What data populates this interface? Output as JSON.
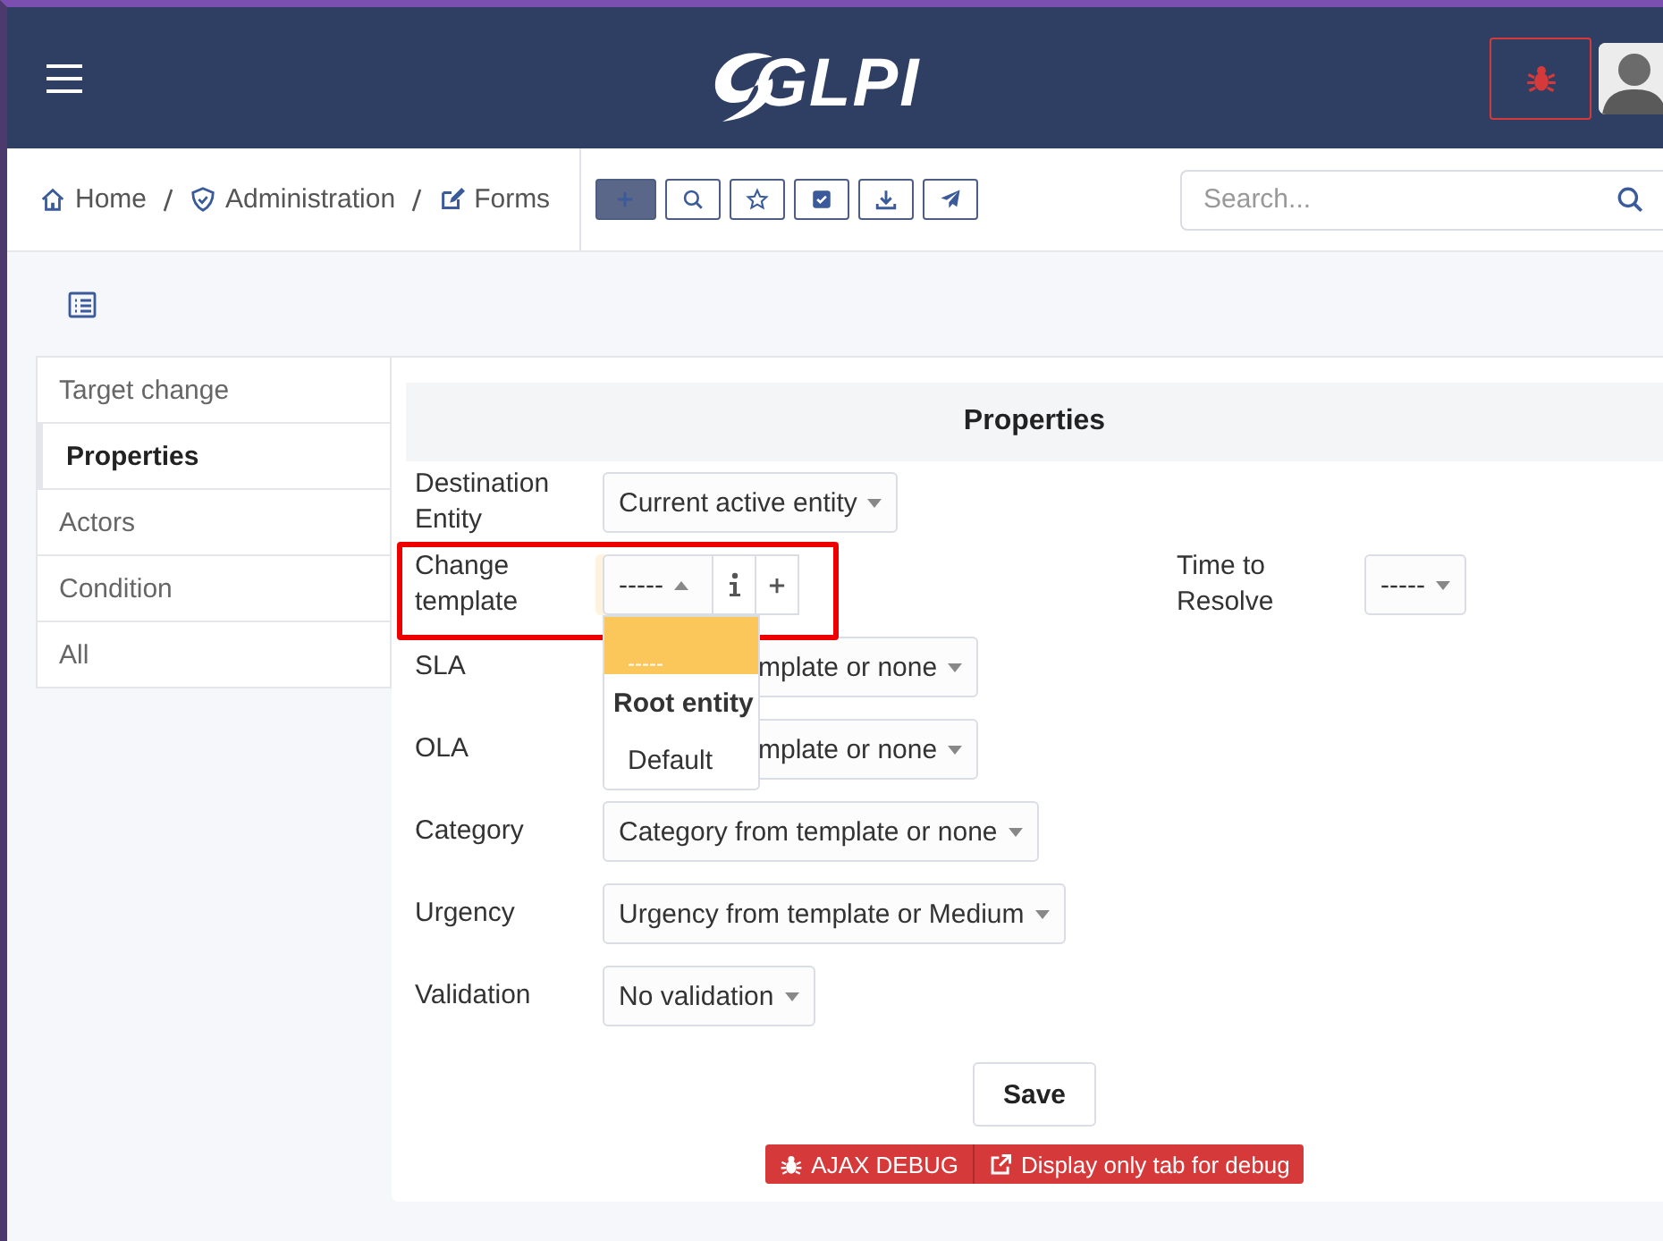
{
  "header": {
    "logo": "GLPI",
    "debug_active": true
  },
  "breadcrumb": [
    {
      "label": "Home"
    },
    {
      "label": "Administration"
    },
    {
      "label": "Forms"
    }
  ],
  "toolbar": [
    {
      "kind": "add"
    },
    {
      "kind": "search"
    },
    {
      "kind": "star"
    },
    {
      "kind": "check"
    },
    {
      "kind": "download"
    },
    {
      "kind": "send"
    }
  ],
  "search": {
    "placeholder": "Search..."
  },
  "tabs": [
    {
      "label": "Target change",
      "selected": false
    },
    {
      "label": "Properties",
      "selected": true
    },
    {
      "label": "Actors",
      "selected": false
    },
    {
      "label": "Condition",
      "selected": false
    },
    {
      "label": "All",
      "selected": false
    }
  ],
  "form": {
    "title": "Properties",
    "rows": [
      [
        {
          "label": "Destination Entity",
          "value": "Current active entity"
        }
      ],
      [
        {
          "label": "Change template",
          "value": "-----",
          "kind": "template",
          "highlighted": true,
          "expanded": true,
          "options": [
            {
              "label": "-----",
              "kind": "item",
              "selected": true
            },
            {
              "label": "Root entity",
              "kind": "group",
              "selected": false
            },
            {
              "label": "Default",
              "kind": "item",
              "selected": false
            }
          ]
        },
        {
          "label": "Time to Resolve",
          "value": "-----"
        }
      ],
      [
        {
          "label": "SLA",
          "value": "mplate or none",
          "kind": "covered"
        }
      ],
      [
        {
          "label": "OLA",
          "value": "mplate or none",
          "kind": "covered"
        }
      ],
      [
        {
          "label": "Category",
          "value": "Category from template or none"
        }
      ],
      [
        {
          "label": "Urgency",
          "value": "Urgency from template or Medium"
        }
      ],
      [
        {
          "label": "Validation",
          "value": "No validation"
        }
      ]
    ],
    "save": "Save"
  },
  "debug": [
    {
      "label": "AJAX DEBUG"
    },
    {
      "label": "Display only tab for debug"
    }
  ]
}
